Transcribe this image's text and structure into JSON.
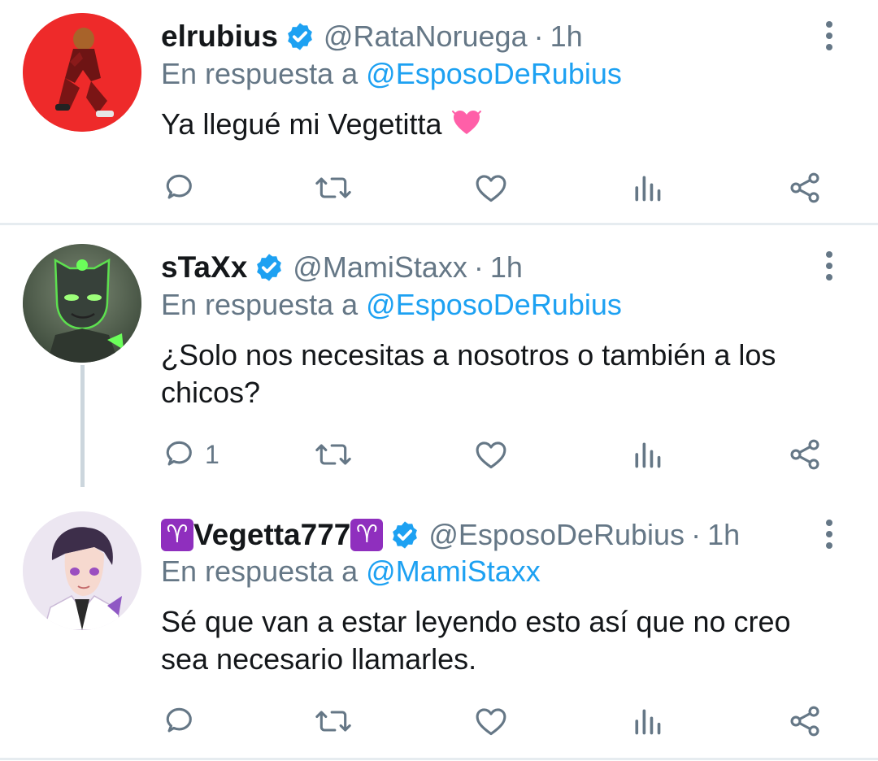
{
  "tweets": [
    {
      "name": "elrubius",
      "handle": "@RataNoruega",
      "dot": "·",
      "time": "1h",
      "reply_prefix": "En respuesta a",
      "reply_to": "@EsposoDeRubius",
      "text": "Ya llegué mi Vegetitta",
      "emoji": "heart-emoji",
      "reply_count": ""
    },
    {
      "name": "sTaXx",
      "handle": "@MamiStaxx",
      "dot": "·",
      "time": "1h",
      "reply_prefix": "En respuesta a",
      "reply_to": "@EsposoDeRubius",
      "text_line1": "¿Solo nos necesitas a nosotros o también a los",
      "text_line2": "chicos?",
      "reply_count": "1"
    },
    {
      "name_prefix_emoji": "♈",
      "name": "Vegetta777",
      "name_suffix_emoji": "♈",
      "handle": "@EsposoDeRubius",
      "dot": "·",
      "time": "1h",
      "reply_prefix": "En respuesta a",
      "reply_to": "@MamiStaxx",
      "text_line1": "Sé que van a estar leyendo esto así que no creo",
      "text_line2": "sea necesario llamarles.",
      "reply_count": ""
    }
  ],
  "colors": {
    "link": "#1da1f2",
    "muted": "#657786",
    "text": "#14171a",
    "verified": "#1da1f2",
    "divider": "#e6ecf0"
  },
  "icons": [
    "reply-icon",
    "retweet-icon",
    "like-icon",
    "analytics-icon",
    "share-icon",
    "more-options-icon",
    "verified-badge-icon"
  ]
}
